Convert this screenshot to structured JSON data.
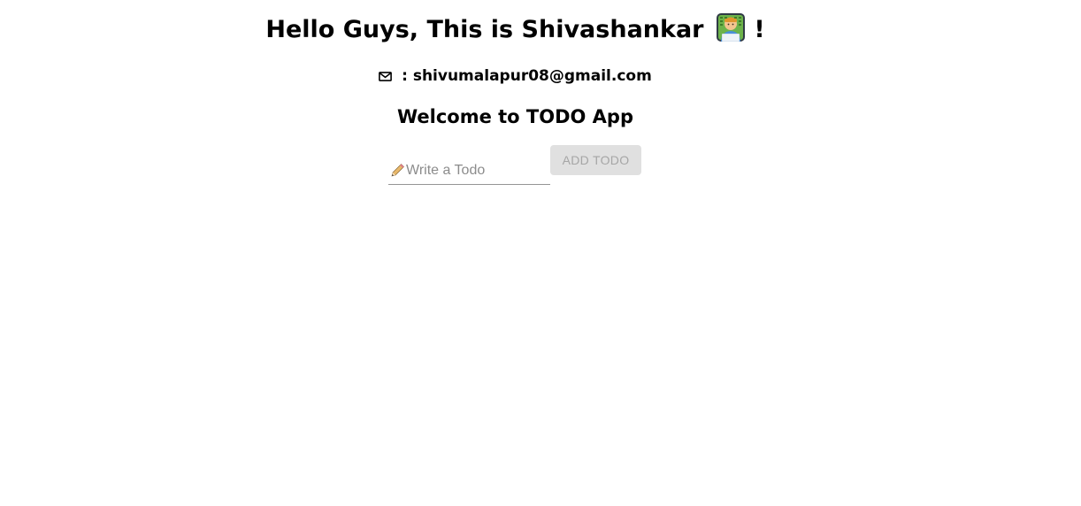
{
  "header": {
    "greeting": "Hello Guys, This is Shivashankar",
    "greeting_icon": "technologist-emoji-icon",
    "greeting_suffix": "!"
  },
  "contact": {
    "icon": "envelope-icon",
    "separator": ":",
    "email": "shivumalapur08@gmail.com"
  },
  "app": {
    "title": "Welcome to TODO App"
  },
  "todo_form": {
    "input_icon": "pencil-icon",
    "input_value": "",
    "input_placeholder": "Write a Todo",
    "add_button_label": "ADD TODO",
    "add_button_disabled": true
  },
  "colors": {
    "background": "#ffffff",
    "text": "#000000",
    "button_disabled_bg": "#e0e0e0",
    "button_disabled_text": "#a6a6a6",
    "input_underline": "#949494",
    "placeholder": "#8c8c8c"
  }
}
